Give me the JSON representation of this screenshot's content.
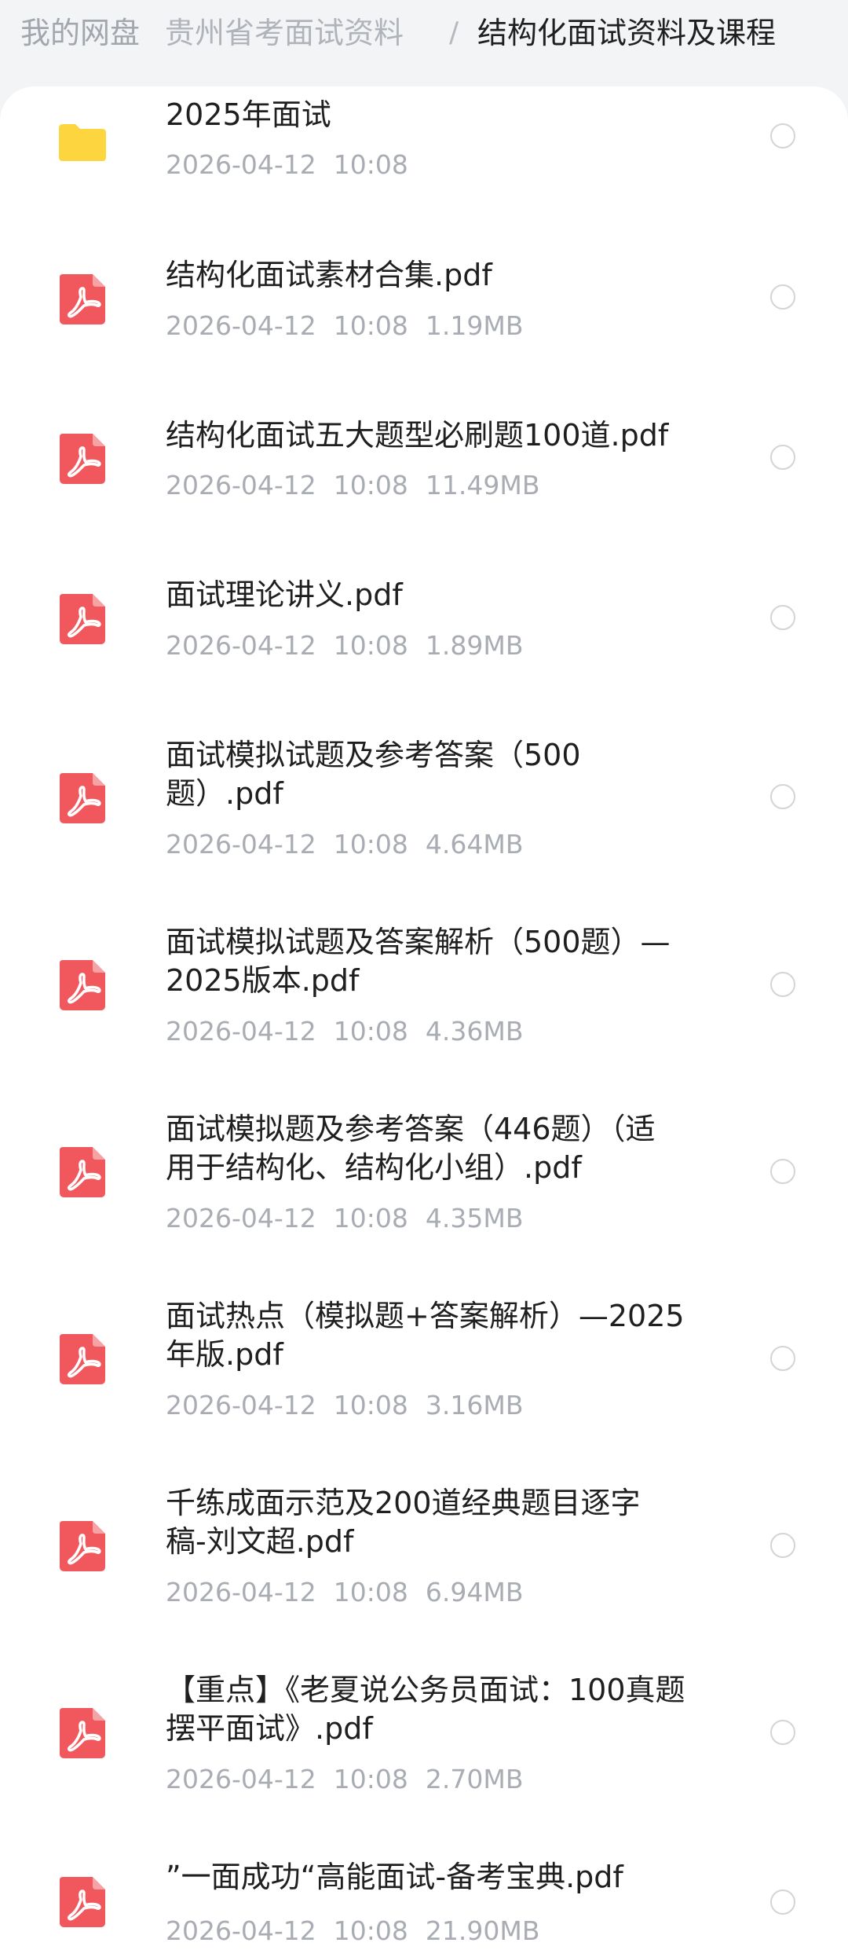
{
  "breadcrumb": {
    "root": "我的网盘",
    "middle": "贵州省考面试资料",
    "separator": "/",
    "current": "结构化面试资料及课程"
  },
  "colors": {
    "folder": "#fcd53f",
    "pdf": "#f0585d",
    "meta_text": "#a9adb3"
  },
  "files": [
    {
      "type": "folder",
      "icon": "folder-icon",
      "name": "2025年面试",
      "date": "2026-04-12",
      "time": "10:08",
      "size": ""
    },
    {
      "type": "pdf",
      "icon": "pdf-icon",
      "name": "结构化面试素材合集.pdf",
      "date": "2026-04-12",
      "time": "10:08",
      "size": "1.19MB"
    },
    {
      "type": "pdf",
      "icon": "pdf-icon",
      "name": "结构化面试五大题型必刷题100道.pdf",
      "date": "2026-04-12",
      "time": "10:08",
      "size": "11.49MB"
    },
    {
      "type": "pdf",
      "icon": "pdf-icon",
      "name": "面试理论讲义.pdf",
      "date": "2026-04-12",
      "time": "10:08",
      "size": "1.89MB"
    },
    {
      "type": "pdf",
      "icon": "pdf-icon",
      "name": "面试模拟试题及参考答案（500\n题）.pdf",
      "date": "2026-04-12",
      "time": "10:08",
      "size": "4.64MB"
    },
    {
      "type": "pdf",
      "icon": "pdf-icon",
      "name": "面试模拟试题及答案解析（500题）—\n2025版本.pdf",
      "date": "2026-04-12",
      "time": "10:08",
      "size": "4.36MB"
    },
    {
      "type": "pdf",
      "icon": "pdf-icon",
      "name": "面试模拟题及参考答案（446题）（适\n用于结构化、结构化小组）.pdf",
      "date": "2026-04-12",
      "time": "10:08",
      "size": "4.35MB"
    },
    {
      "type": "pdf",
      "icon": "pdf-icon",
      "name": "面试热点（模拟题+答案解析）—2025\n年版.pdf",
      "date": "2026-04-12",
      "time": "10:08",
      "size": "3.16MB"
    },
    {
      "type": "pdf",
      "icon": "pdf-icon",
      "name": "千练成面示范及200道经典题目逐字\n稿-刘文超.pdf",
      "date": "2026-04-12",
      "time": "10:08",
      "size": "6.94MB"
    },
    {
      "type": "pdf",
      "icon": "pdf-icon",
      "name": "【重点】《老夏说公务员面试：100真题\n摆平面试》.pdf",
      "date": "2026-04-12",
      "time": "10:08",
      "size": "2.70MB"
    },
    {
      "type": "pdf",
      "icon": "pdf-icon",
      "name": "”一面成功“高能面试-备考宝典.pdf",
      "date": "2026-04-12",
      "time": "10:08",
      "size": "21.90MB"
    }
  ]
}
